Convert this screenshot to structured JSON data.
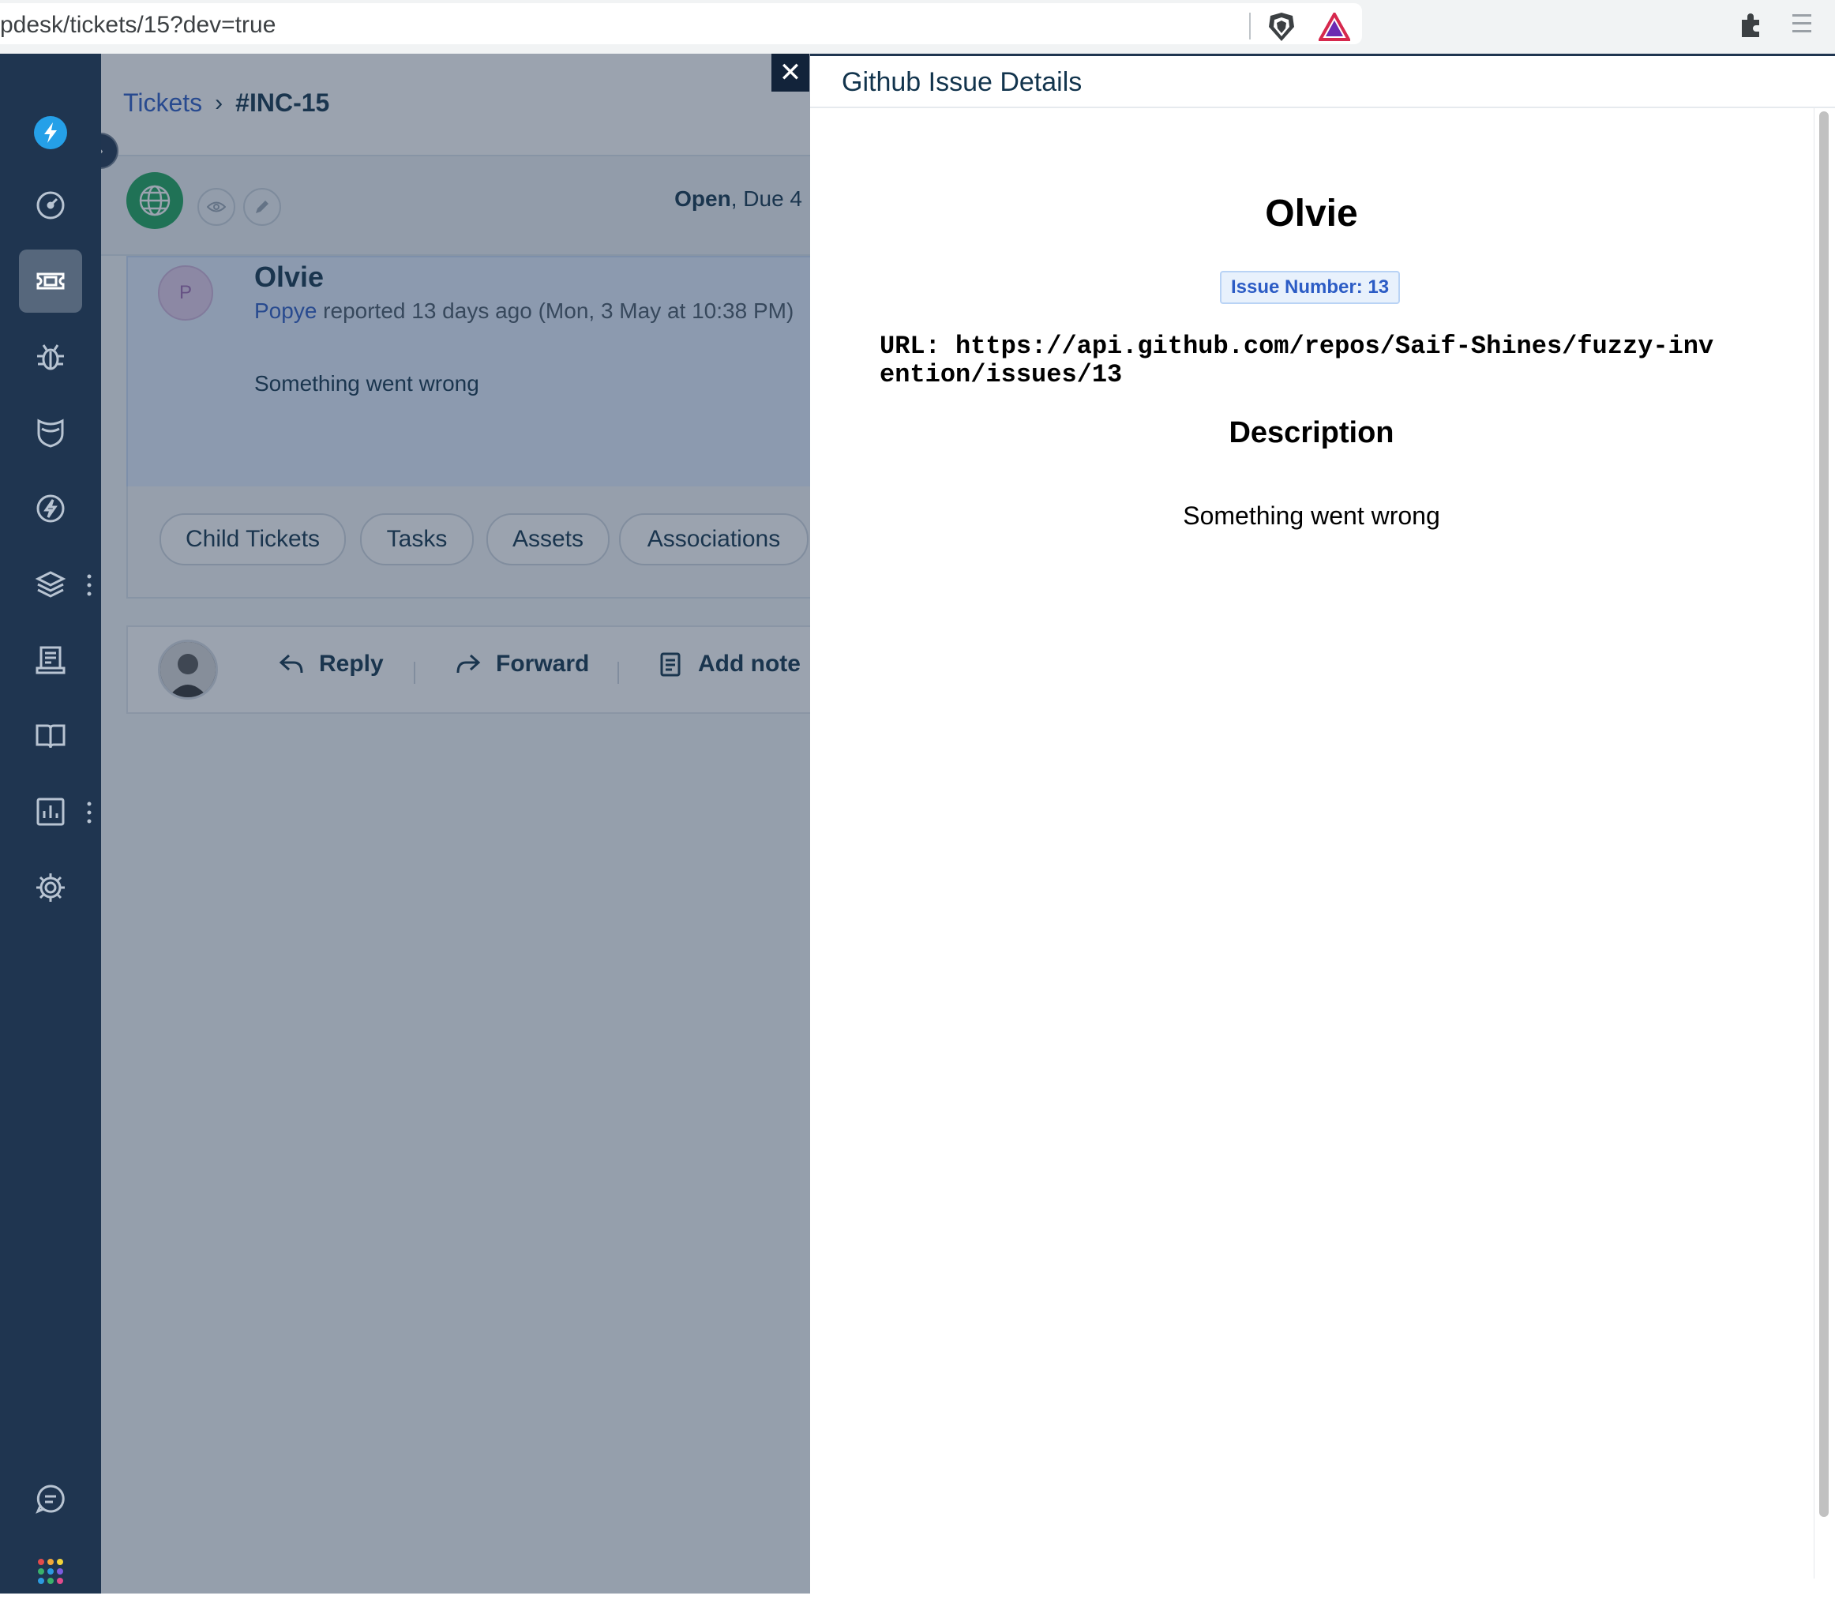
{
  "browser": {
    "url": "pdesk/tickets/15?dev=true",
    "icons": [
      "brave-shield-icon",
      "brave-rewards-icon",
      "extensions-icon",
      "menu-icon"
    ]
  },
  "sidebar": {
    "items": [
      {
        "name": "logo-icon"
      },
      {
        "name": "dashboard-icon"
      },
      {
        "name": "tickets-icon",
        "active": true
      },
      {
        "name": "problems-icon"
      },
      {
        "name": "changes-icon"
      },
      {
        "name": "releases-icon"
      },
      {
        "name": "assets-icon"
      },
      {
        "name": "contracts-icon"
      },
      {
        "name": "solutions-icon"
      },
      {
        "name": "analytics-icon"
      },
      {
        "name": "admin-icon"
      },
      {
        "name": "chat-icon"
      },
      {
        "name": "apps-icon"
      }
    ]
  },
  "main": {
    "breadcrumb": {
      "root": "Tickets",
      "current": "#INC-15"
    },
    "status": {
      "state": "Open",
      "due": ", Due 4"
    },
    "ticket": {
      "subject": "Olvie",
      "reporter_initial": "P",
      "reporter_name": "Popye",
      "reported_text": " reported 13 days ago (Mon, 3 May at 10:38 PM)",
      "body": "Something went wrong"
    },
    "tabs": [
      "Child Tickets",
      "Tasks",
      "Assets",
      "Associations"
    ],
    "actions": {
      "reply": "Reply",
      "forward": "Forward",
      "add_note": "Add note"
    }
  },
  "drawer": {
    "close_label": "✕",
    "title": "Github Issue Details",
    "issue": {
      "name": "Olvie",
      "number_label": "Issue Number: 13",
      "url_label": "URL: https://api.github.com/repos/Saif-Shines/fuzzy-invention/issues/13",
      "description_heading": "Description",
      "description": "Something went wrong"
    }
  },
  "colors": {
    "sidebar_bg": "#1f3550",
    "link": "#2c5cc5",
    "text_dark": "#12344d",
    "badge_bg": "#e8f1fc",
    "overlay": "rgba(38,55,80,0.46)"
  }
}
